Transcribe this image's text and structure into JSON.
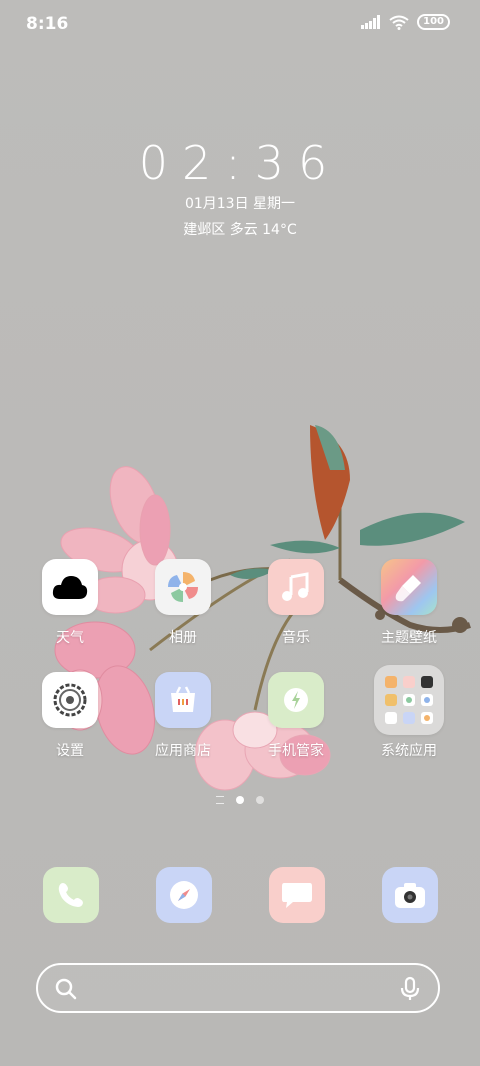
{
  "status_bar": {
    "time": "8:16",
    "battery": "100"
  },
  "lock_clock": {
    "time": "02:36",
    "date": "01月13日 星期一",
    "weather": "建邺区 多云 14°C"
  },
  "apps": [
    {
      "label": "天气"
    },
    {
      "label": "相册"
    },
    {
      "label": "音乐"
    },
    {
      "label": "主题壁纸"
    },
    {
      "label": "设置"
    },
    {
      "label": "应用商店"
    },
    {
      "label": "手机管家"
    },
    {
      "label": "系统应用"
    }
  ],
  "dock": [
    {
      "icon": "phone-icon"
    },
    {
      "icon": "browser-compass-icon"
    },
    {
      "icon": "messages-icon"
    },
    {
      "icon": "camera-icon"
    }
  ],
  "search": {
    "placeholder": ""
  },
  "colors": {
    "phone": "#d9ecc9",
    "browser": "#c9d5f6",
    "messages": "#f9cfcb",
    "camera": "#c9d5f6",
    "gallery": "#f3f3f3",
    "music": "#f9cfcb",
    "security": "#d9ecc9",
    "store": "#c9d5f6"
  }
}
